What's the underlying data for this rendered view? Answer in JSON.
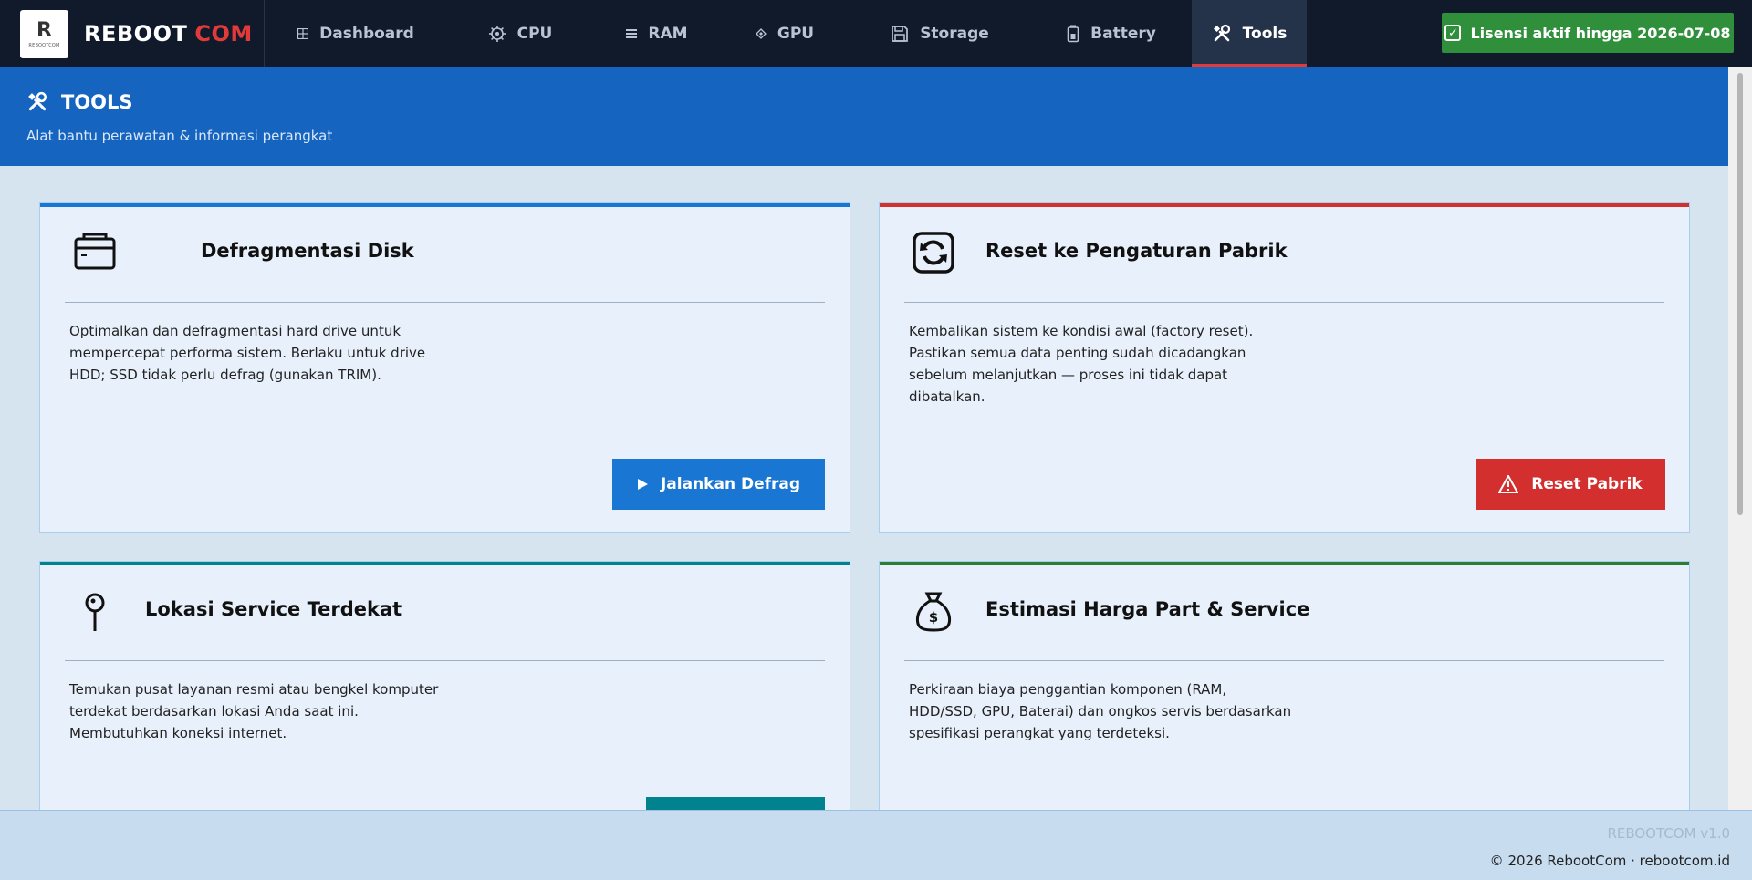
{
  "brand": {
    "logo_letter": "R",
    "logo_sub": "REBOOTCOM",
    "name_primary": "REBOOT",
    "name_accent": "COM",
    "accent_color": "#e03a3a"
  },
  "nav": {
    "items": [
      {
        "label": "Dashboard",
        "icon": "grid-icon"
      },
      {
        "label": "CPU",
        "icon": "cpu-icon"
      },
      {
        "label": "RAM",
        "icon": "memory-icon"
      },
      {
        "label": "GPU",
        "icon": "gpu-icon"
      },
      {
        "label": "Storage",
        "icon": "floppy-disk-icon"
      },
      {
        "label": "Battery",
        "icon": "battery-icon"
      },
      {
        "label": "Tools",
        "icon": "tools-icon",
        "active": true
      }
    ],
    "license_label": "Lisensi aktif hingga 2026-07-08",
    "license_color": "#2f8f3b"
  },
  "hero": {
    "title": "TOOLS",
    "subtitle": "Alat bantu perawatan & informasi perangkat",
    "background": "#1565c0"
  },
  "cards": [
    {
      "title": "Defragmentasi Disk",
      "icon": "folder-disk-icon",
      "accent": "#1976d2",
      "description": "Optimalkan dan defragmentasi hard drive untuk mempercepat performa sistem. Berlaku untuk drive HDD; SSD tidak perlu defrag (gunakan TRIM).",
      "button_label": "Jalankan Defrag",
      "button_icon": "play-icon",
      "button_color": "#1976d2"
    },
    {
      "title": "Reset ke Pengaturan Pabrik",
      "icon": "refresh-icon",
      "accent": "#d32f2f",
      "description": "Kembalikan sistem ke kondisi awal (factory reset). Pastikan semua data penting sudah dicadangkan sebelum melanjutkan — proses ini tidak dapat dibatalkan.",
      "button_label": "Reset Pabrik",
      "button_icon": "warning-icon",
      "button_color": "#d32f2f"
    },
    {
      "title": "Lokasi Service Terdekat",
      "icon": "map-pin-icon",
      "accent": "#00838f",
      "description": "Temukan pusat layanan resmi atau bengkel komputer terdekat berdasarkan lokasi Anda saat ini. Membutuhkan koneksi internet.",
      "button_label": "",
      "button_color": "#00838f"
    },
    {
      "title": "Estimasi Harga Part & Service",
      "icon": "money-bag-icon",
      "accent": "#2e7d32",
      "description": "Perkiraan biaya penggantian komponen (RAM, HDD/SSD, GPU, Baterai) dan ongkos servis berdasarkan spesifikasi perangkat yang terdeteksi."
    }
  ],
  "footer": {
    "version": "REBOOTCOM v1.0",
    "copyright": "© 2026 RebootCom · rebootcom.id"
  }
}
